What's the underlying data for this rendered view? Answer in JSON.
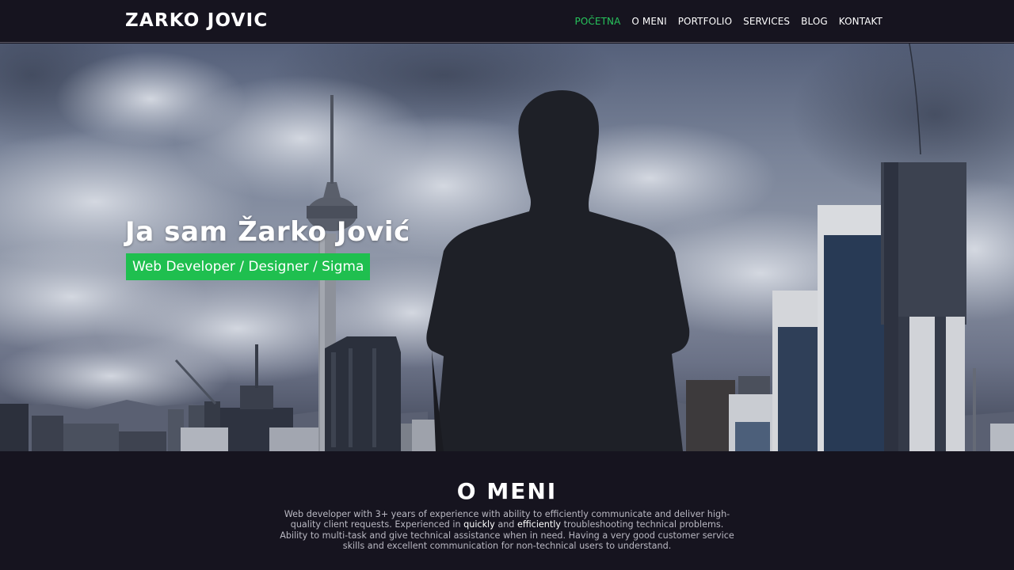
{
  "navbar": {
    "brand": "ZARKO JOVIC",
    "items": [
      {
        "label": "POČETNA",
        "active": true
      },
      {
        "label": "O MENI",
        "active": false
      },
      {
        "label": "PORTFOLIO",
        "active": false
      },
      {
        "label": "SERVICES",
        "active": false
      },
      {
        "label": "BLOG",
        "active": false
      },
      {
        "label": "KONTAKT",
        "active": false
      }
    ]
  },
  "hero": {
    "title": "Ja sam Žarko Jović",
    "subtitle": "Web Developer / Designer / Sigma"
  },
  "about": {
    "title": "O MENI",
    "text_1": "Web developer with 3+ years of experience with ability to efficiently communicate and deliver high-quality client requests. Experienced in ",
    "emph_1": "quickly",
    "text_2": " and ",
    "emph_2": "efficiently",
    "text_3": " troubleshooting technical problems. Ability to multi-task and give technical assistance when in need. Having a very good customer service skills and excellent communication for non-technical users to understand."
  },
  "colors": {
    "accent": "#1fbf4f",
    "nav_active": "#27c45c",
    "background": "#16141f"
  }
}
